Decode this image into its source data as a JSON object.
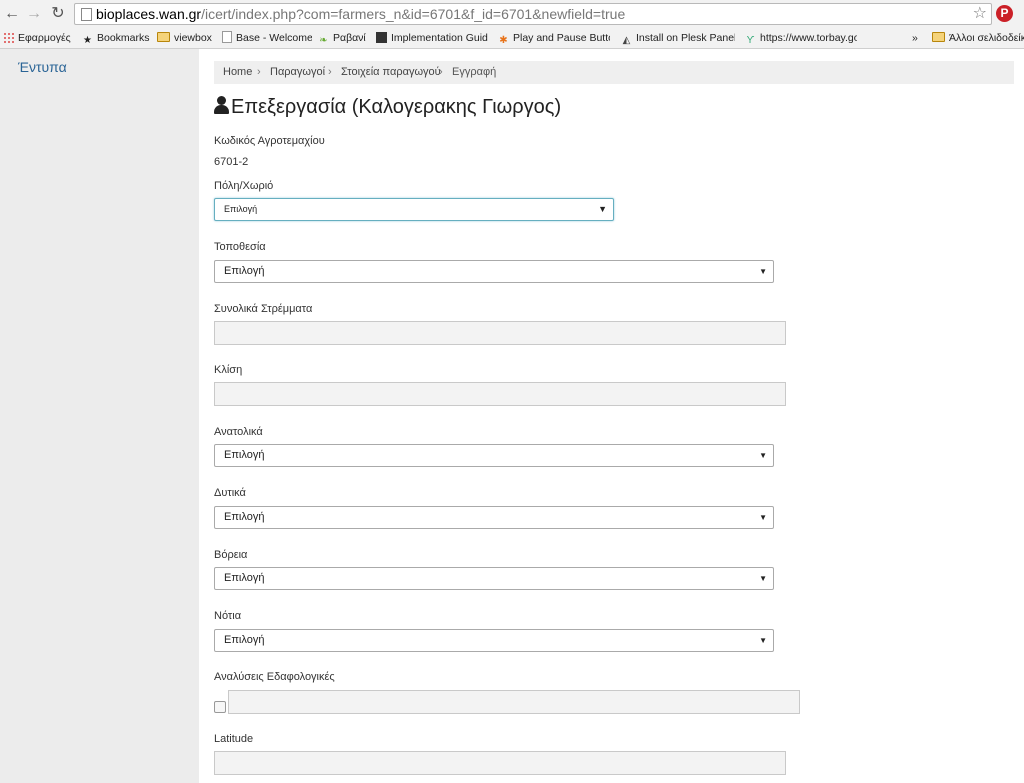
{
  "browser": {
    "url_host": "bioplaces.wan.gr",
    "url_rest": "/icert/index.php?com=farmers_n&id=6701&f_id=6701&newfield=true",
    "bookmarks": [
      {
        "label": "Εφαρμογές",
        "icon": "apps-grid-icon"
      },
      {
        "label": "Bookmarks",
        "icon": "star-icon"
      },
      {
        "label": "viewbox",
        "icon": "folder-icon"
      },
      {
        "label": "Base - Welcome",
        "icon": "page-icon"
      },
      {
        "label": "Ραβανί",
        "icon": "leaf-icon"
      },
      {
        "label": "Implementation Guide",
        "icon": "site-icon"
      },
      {
        "label": "Play and Pause Button",
        "icon": "asterisk-icon"
      },
      {
        "label": "Install on Plesk Panel",
        "icon": "site-icon"
      },
      {
        "label": "https://www.torbay.gov",
        "icon": "palm-icon"
      }
    ],
    "overflow": "»",
    "other_bookmarks": "Άλλοι σελιδοδείκτες"
  },
  "sidebar": {
    "link": "Έντυπα"
  },
  "breadcrumb": [
    "Home",
    "Παραγωγοί",
    "Στοιχεία παραγωγού",
    "Εγγραφή"
  ],
  "breadcrumb_sep": "›",
  "title": "Επεξεργασία (Καλογερακης Γιωργος)",
  "form": {
    "code_label": "Κωδικός Αγροτεμαχίου",
    "code_value": "6701-2",
    "city_label": "Πόλη/Χωριό",
    "city_value": "Επιλογή",
    "location_label": "Τοποθεσία",
    "location_value": "Επιλογή",
    "stremmata_label": "Συνολικά Στρέμματα",
    "slope_label": "Κλίση",
    "east_label": "Ανατολικά",
    "east_value": "Επιλογή",
    "west_label": "Δυτικά",
    "west_value": "Επιλογή",
    "north_label": "Βόρεια",
    "north_value": "Επιλογή",
    "south_label": "Νότια",
    "south_value": "Επιλογή",
    "soil_label": "Αναλύσεις Εδαφολογικές",
    "latitude_label": "Latitude"
  },
  "colors": {
    "link": "#2a6496",
    "sidebar": "#ececec",
    "pinterest": "#cb2027"
  }
}
